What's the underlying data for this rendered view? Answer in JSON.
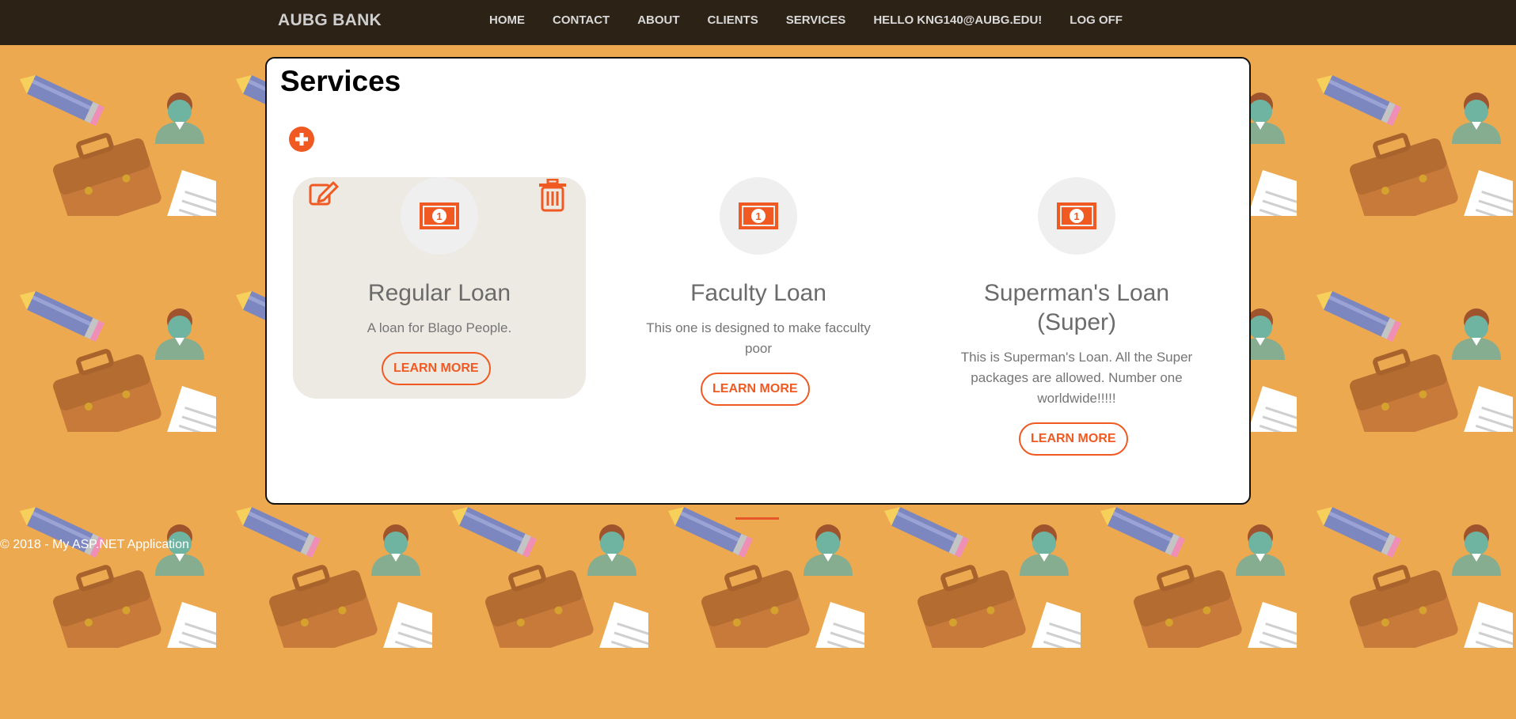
{
  "navbar": {
    "brand": "AUBG BANK",
    "links": [
      {
        "label": "HOME"
      },
      {
        "label": "CONTACT"
      },
      {
        "label": "ABOUT"
      },
      {
        "label": "CLIENTS"
      },
      {
        "label": "SERVICES"
      },
      {
        "label": "HELLO KNG140@AUBG.EDU!"
      },
      {
        "label": "LOG OFF"
      }
    ]
  },
  "page": {
    "title": "Services"
  },
  "icons": {
    "add": "plus-circle-icon",
    "edit": "edit-icon",
    "delete": "trash-icon",
    "service": "money-bill-icon"
  },
  "services": [
    {
      "title": "Regular Loan",
      "description": "A loan for Blago People.",
      "button": "LEARN MORE"
    },
    {
      "title": "Faculty Loan",
      "description": "This one is designed to make faccultу poor",
      "button": "LEARN MORE"
    },
    {
      "title": "Superman's Loan (Super)",
      "description": "This is Superman's Loan. All the Super packages are allowed. Number one worldwide!!!!!",
      "button": "LEARN MORE"
    }
  ],
  "footer": {
    "text": "© 2018 - My ASP.NET Application"
  },
  "colors": {
    "accent": "#f05a22",
    "background": "#eda94f",
    "navbar": "#2c2216",
    "card_highlight": "#edeae4"
  }
}
